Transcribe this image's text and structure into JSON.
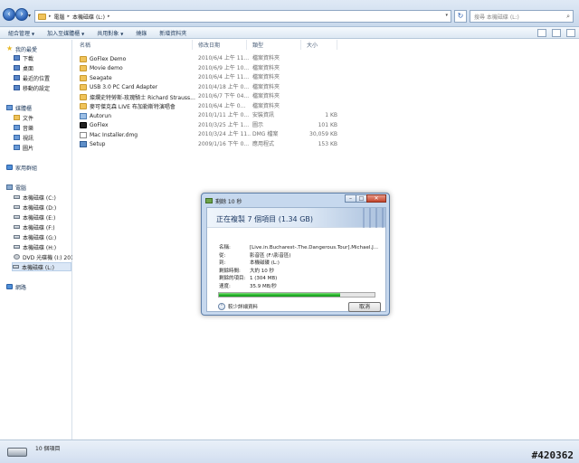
{
  "address": {
    "crumbs": [
      "電腦",
      "本機磁碟 (L:)"
    ],
    "search_placeholder": "搜尋 本機磁碟 (L:)"
  },
  "toolbar": {
    "items": [
      "組合管理",
      "加入至媒體櫃",
      "共用對象",
      "燒錄",
      "新增資料夾"
    ]
  },
  "navpane": {
    "favorites": {
      "label": "我的最愛",
      "items": [
        "下載",
        "桌面",
        "最近的位置",
        "移動的設定"
      ]
    },
    "libraries": {
      "label": "媒體櫃",
      "items": [
        "文件",
        "音樂",
        "視訊",
        "圖片"
      ]
    },
    "homegroup": "家用群組",
    "computer": {
      "label": "電腦",
      "items": [
        "本機磁碟 (C:)",
        "本機磁碟 (D:)",
        "本機磁碟 (E:)",
        "本機磁碟 (F:)",
        "本機磁碟 (G:)",
        "本機磁碟 (H:)",
        "DVD 光碟機 (I:) 201",
        "本機磁碟 (L:)"
      ]
    },
    "network": "網路"
  },
  "columns": {
    "name": "名稱",
    "date": "修改日期",
    "type": "類型",
    "size": "大小"
  },
  "files": [
    {
      "icon": "folder-icon",
      "name": "GoFlex Demo",
      "date": "2010/6/4 上午 11...",
      "type": "檔案資料夾",
      "size": ""
    },
    {
      "icon": "folder-icon",
      "name": "Movie demo",
      "date": "2010/6/9 上午 10...",
      "type": "檔案資料夾",
      "size": ""
    },
    {
      "icon": "folder-icon",
      "name": "Seagate",
      "date": "2010/6/4 上午 11...",
      "type": "檔案資料夾",
      "size": ""
    },
    {
      "icon": "folder-icon",
      "name": "USB 3.0 PC Card Adapter",
      "date": "2010/4/18 上午 0...",
      "type": "檔案資料夾",
      "size": ""
    },
    {
      "icon": "folder-icon",
      "name": "燦爛史特勞斯-玫瑰騎士 Richard Strauss...",
      "date": "2010/6/7 下午 04...",
      "type": "檔案資料夾",
      "size": ""
    },
    {
      "icon": "folder-icon",
      "name": "麥可傑克森 LIVE 布加勒斯特演唱會",
      "date": "2010/6/4 上午 0...",
      "type": "檔案資料夾",
      "size": ""
    },
    {
      "icon": "autorun-icon",
      "name": "Autorun",
      "date": "2010/1/11 上午 0...",
      "type": "安裝資訊",
      "size": "1 KB"
    },
    {
      "icon": "goflex-icon",
      "name": "GoFlex",
      "date": "2010/3/25 上午 1...",
      "type": "圖示",
      "size": "101 KB"
    },
    {
      "icon": "dmg-icon",
      "name": "Mac Installer.dmg",
      "date": "2010/3/24 上午 11...",
      "type": "DMG 檔案",
      "size": "30,059 KB"
    },
    {
      "icon": "setup-icon",
      "name": "Setup",
      "date": "2009/1/16 下午 0...",
      "type": "應用程式",
      "size": "153 KB"
    }
  ],
  "status": {
    "count": "10 個項目"
  },
  "watermark": "#420362",
  "dialog": {
    "title": "剩餘 10 秒",
    "heading": "正在複製 7 個項目 (1.34 GB)",
    "rows": [
      {
        "k": "名稱:",
        "v": "[Live.in.Bucharest-.The.Dangerous.Tour].Michael.J..."
      },
      {
        "k": "從:",
        "v": "影音區 (F:\\影音區)"
      },
      {
        "k": "到:",
        "v": "本機磁碟 (L:)"
      },
      {
        "k": "剩餘時間:",
        "v": "大約 10 秒"
      },
      {
        "k": "剩餘的項目:",
        "v": "1 (304 MB)"
      },
      {
        "k": "速度:",
        "v": "35.9 MB/秒"
      }
    ],
    "progress": 0.78,
    "more_label": "較少詳細資料",
    "cancel_label": "取消"
  }
}
